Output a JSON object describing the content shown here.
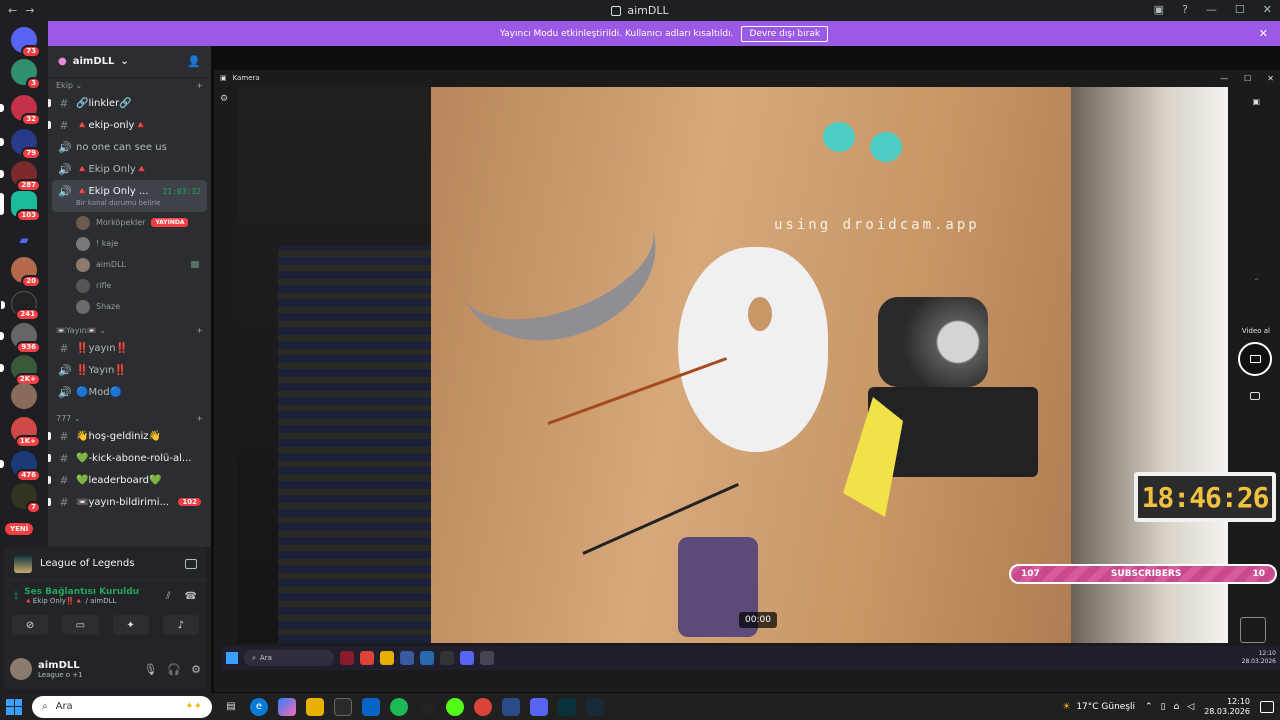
{
  "window": {
    "title": "aimDLL"
  },
  "banner": {
    "text": "Yayıncı Modu etkinleştirildi. Kullanıcı adları kısaltıldı.",
    "button": "Devre dışı bırak"
  },
  "guild_badges": [
    "73",
    "3",
    "32",
    "79",
    "287",
    "103",
    "",
    "20",
    "241",
    "936",
    "2K+",
    "",
    "1K+",
    "476",
    "7"
  ],
  "yeni": "YENİ",
  "server": {
    "name": "aimDLL"
  },
  "categories": {
    "ekip": "Ekip",
    "yayin": "Yayın",
    "777": "777"
  },
  "channels": [
    {
      "label": "🔗linkler🔗",
      "sym": "#"
    },
    {
      "label": "🔺ekip-only🔺",
      "sym": "#"
    },
    {
      "label": "no one can see us",
      "sym": "🔊"
    },
    {
      "label": "🔺Ekip Only🔺",
      "sym": "🔊"
    }
  ],
  "active_voice": {
    "label": "🔺Ekip Only ...",
    "time": "21:03:32",
    "status": "Bir kanal durumu belirle"
  },
  "voice_users": [
    {
      "name": "Morköpekler",
      "live": "YAYINDA"
    },
    {
      "name": "! kaje"
    },
    {
      "name": "aimDLL"
    },
    {
      "name": "rifle"
    },
    {
      "name": "Shaze"
    }
  ],
  "yayin_channels": [
    {
      "label": "‼️yayın‼️",
      "sym": "#"
    },
    {
      "label": "‼️Yayın‼️",
      "sym": "🔊"
    },
    {
      "label": "🔵Mod🔵",
      "sym": "🔊"
    }
  ],
  "ch777": [
    {
      "label": "👋hoş-geldiniz👋",
      "sym": "#"
    },
    {
      "label": "💚-kick-abone-rolü-al...",
      "sym": "#"
    },
    {
      "label": "💚leaderboard💚",
      "sym": "#"
    },
    {
      "label": "📼yayın-bildirimi...",
      "sym": "#",
      "badge": "102"
    }
  ],
  "activity": {
    "game": "League of Legends"
  },
  "voice": {
    "status": "Ses Bağlantısı Kuruldu",
    "channel": "🔺Ekip Only‼️🔺 / aimDLL"
  },
  "user": {
    "name": "aimDLL",
    "status": "League o +1"
  },
  "camera": {
    "title": "Kamera",
    "watermark": "using droidcam.app",
    "timecode": "00:00",
    "video_label": "Video al"
  },
  "overlay": {
    "clock": "18:46:26",
    "subs_left": "107",
    "subs_label": "SUBSCRIBERS",
    "subs_right": "10"
  },
  "inner_taskbar": {
    "search": "Ara",
    "time": "12:10",
    "date": "28.03.2026"
  },
  "taskbar": {
    "search": "Ara",
    "weather": "17°C Güneşli",
    "time": "12:10",
    "date": "28.03.2026"
  }
}
